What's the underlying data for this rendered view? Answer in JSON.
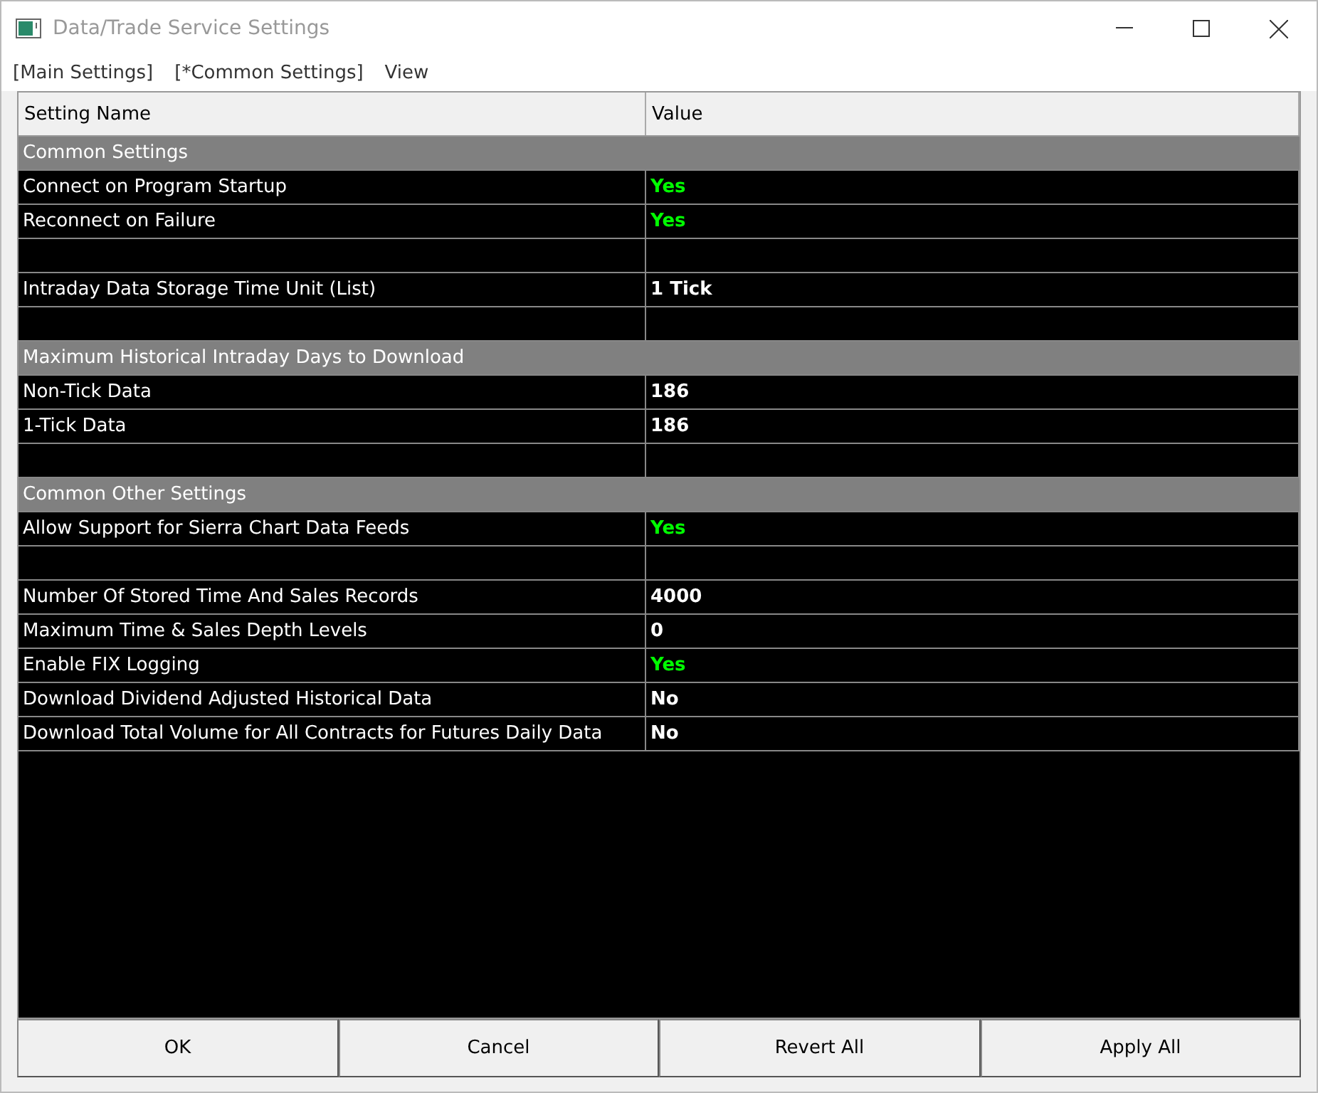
{
  "window": {
    "title": "Data/Trade Service Settings"
  },
  "menu": [
    "[Main Settings]",
    "[*Common Settings]",
    "View"
  ],
  "table": {
    "columns": [
      "Setting Name",
      "Value"
    ],
    "rows": [
      {
        "kind": "section",
        "name": "Common Settings"
      },
      {
        "kind": "setting",
        "name": "Connect on Program Startup",
        "value": "Yes",
        "color": "#00ff00"
      },
      {
        "kind": "setting",
        "name": "Reconnect on Failure",
        "value": "Yes",
        "color": "#00ff00"
      },
      {
        "kind": "blank"
      },
      {
        "kind": "setting",
        "name": "Intraday Data Storage Time Unit (List)",
        "value": "1 Tick",
        "color": "#ffffff"
      },
      {
        "kind": "blank"
      },
      {
        "kind": "section",
        "name": "Maximum Historical Intraday Days to Download"
      },
      {
        "kind": "setting",
        "name": "Non-Tick Data",
        "value": "186",
        "color": "#ffffff"
      },
      {
        "kind": "setting",
        "name": "1-Tick Data",
        "value": "186",
        "color": "#ffffff"
      },
      {
        "kind": "blank"
      },
      {
        "kind": "section",
        "name": "Common Other Settings"
      },
      {
        "kind": "setting",
        "name": "Allow Support for Sierra Chart Data Feeds",
        "value": "Yes",
        "color": "#00ff00"
      },
      {
        "kind": "blank"
      },
      {
        "kind": "setting",
        "name": "Number Of Stored Time And Sales Records",
        "value": "4000",
        "color": "#ffffff"
      },
      {
        "kind": "setting",
        "name": "Maximum Time & Sales Depth Levels",
        "value": "0",
        "color": "#ffffff"
      },
      {
        "kind": "setting",
        "name": "Enable FIX Logging",
        "value": "Yes",
        "color": "#00ff00"
      },
      {
        "kind": "setting",
        "name": "Download Dividend Adjusted Historical Data",
        "value": "No",
        "color": "#ffffff"
      },
      {
        "kind": "setting",
        "name": "Download Total Volume for All Contracts for Futures Daily Data",
        "value": "No",
        "color": "#ffffff"
      }
    ]
  },
  "buttons": [
    "OK",
    "Cancel",
    "Revert All",
    "Apply All"
  ]
}
